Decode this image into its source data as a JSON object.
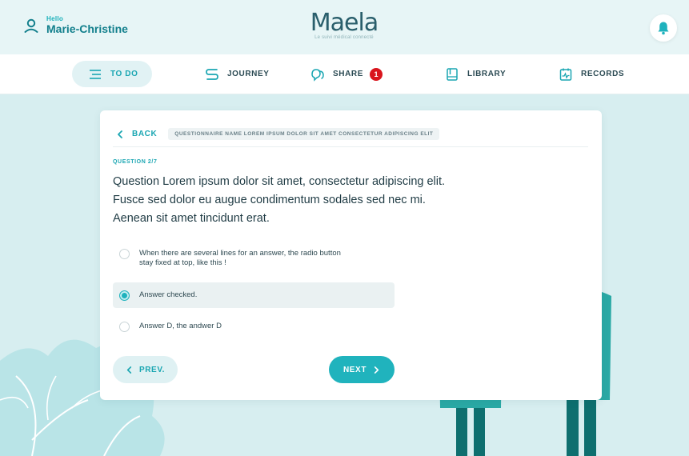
{
  "header": {
    "greeting": "Hello",
    "user_name": "Marie-Christine",
    "logo_text": "Maela",
    "tagline": "Le suivi médical connecté",
    "icons": {
      "user": "user-icon",
      "bell": "bell-icon"
    }
  },
  "nav": {
    "items": [
      {
        "label": "TO DO",
        "icon": "list-icon",
        "active": true
      },
      {
        "label": "JOURNEY",
        "icon": "route-icon"
      },
      {
        "label": "SHARE",
        "icon": "share-icon",
        "badge": "1"
      },
      {
        "label": "LIBRARY",
        "icon": "book-icon"
      },
      {
        "label": "RECORDS",
        "icon": "records-icon"
      }
    ]
  },
  "card": {
    "back_label": "BACK",
    "questionnaire_name": "QUESTIONNAIRE NAME LOREM IPSUM DOLOR SIT AMET CONSECTETUR ADIPISCING ELIT",
    "question_counter": "QUESTION 2/7",
    "question_lines": [
      "Question Lorem ipsum dolor sit amet, consectetur adipiscing elit.",
      "Fusce sed dolor eu augue condimentum sodales sed nec mi.",
      "Aenean sit amet tincidunt erat."
    ],
    "answers": [
      {
        "lines": [
          "When there are several lines for an answer, the radio button",
          "stay fixed at top, like this !"
        ],
        "checked": false
      },
      {
        "lines": [
          "Answer checked."
        ],
        "checked": true
      },
      {
        "lines": [
          "Answer D, the andwer D"
        ],
        "checked": false
      }
    ],
    "prev_label": "PREV.",
    "next_label": "NEXT"
  },
  "colors": {
    "accent": "#20b3bd",
    "accent_light": "#dff1f3",
    "background": "#d7eef0",
    "badge": "#d9151d",
    "text_dark": "#1f3b44"
  }
}
